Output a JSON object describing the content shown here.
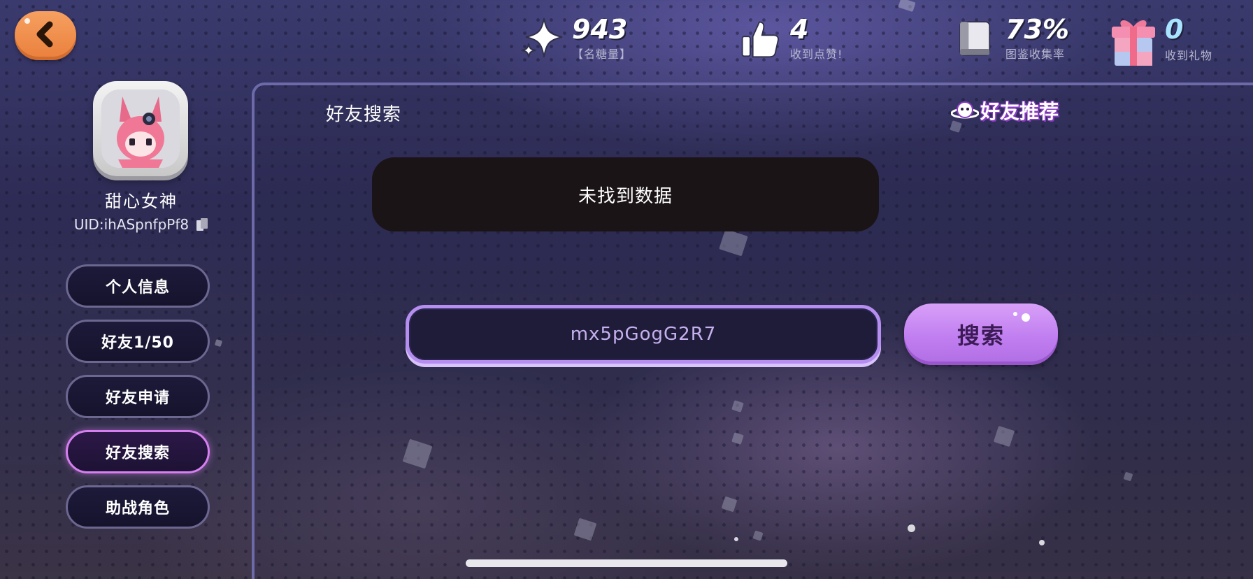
{
  "topbar": {
    "back_icon": "chevron-left-icon",
    "stats": [
      {
        "icon": "sparkle-star-icon",
        "value": "943",
        "label": "【名糖量】"
      },
      {
        "icon": "thumbs-up-icon",
        "value": "4",
        "label": "收到点赞!"
      },
      {
        "icon": "book-icon",
        "value": "73%",
        "label": "图鉴收集率"
      },
      {
        "icon": "gift-box-icon",
        "value": "0",
        "label": "收到礼物"
      }
    ]
  },
  "profile": {
    "name": "甜心女神",
    "uid": "UID:ihASpnfpPf8",
    "copy_icon": "copy-icon"
  },
  "sidebar": {
    "items": [
      {
        "label": "个人信息",
        "active": false
      },
      {
        "label": "好友1/50",
        "active": false
      },
      {
        "label": "好友申请",
        "active": false
      },
      {
        "label": "好友搜索",
        "active": true
      },
      {
        "label": "助战角色",
        "active": false
      }
    ]
  },
  "panel": {
    "title": "好友搜索",
    "recommend_label": "好友推荐",
    "toast_message": "未找到数据",
    "search": {
      "value": "mx5pGogG2R7",
      "button_label": "搜索"
    }
  },
  "colors": {
    "accent_purple": "#c07ef0",
    "back_orange": "#ea7f3c",
    "active_border": "#d77ff0"
  }
}
